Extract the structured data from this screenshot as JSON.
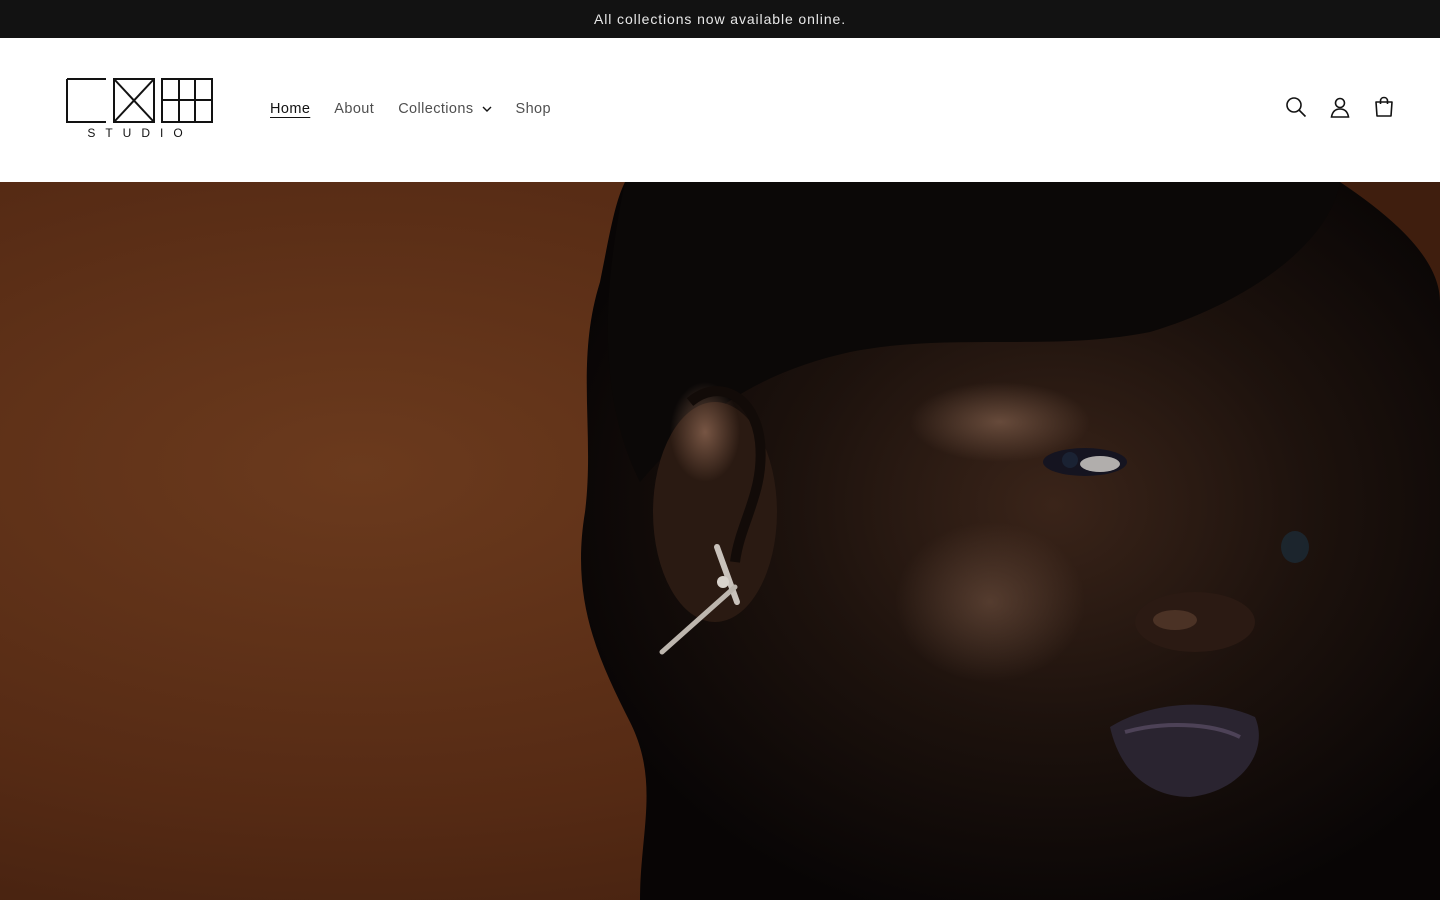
{
  "announcement": {
    "text": "All collections now available online."
  },
  "brand": {
    "logo_text": "STUDIO",
    "logo_mark": "LXM"
  },
  "nav": {
    "items": [
      {
        "label": "Home",
        "active": true
      },
      {
        "label": "About",
        "active": false
      },
      {
        "label": "Collections",
        "active": false,
        "has_dropdown": true
      },
      {
        "label": "Shop",
        "active": false
      }
    ]
  },
  "header_icons": [
    "search-icon",
    "account-icon",
    "cart-icon"
  ],
  "colors": {
    "announcement_bg": "#121212",
    "announcement_text": "#e8e8e8",
    "hero_background": "#5a2e16",
    "text": "#121212"
  }
}
